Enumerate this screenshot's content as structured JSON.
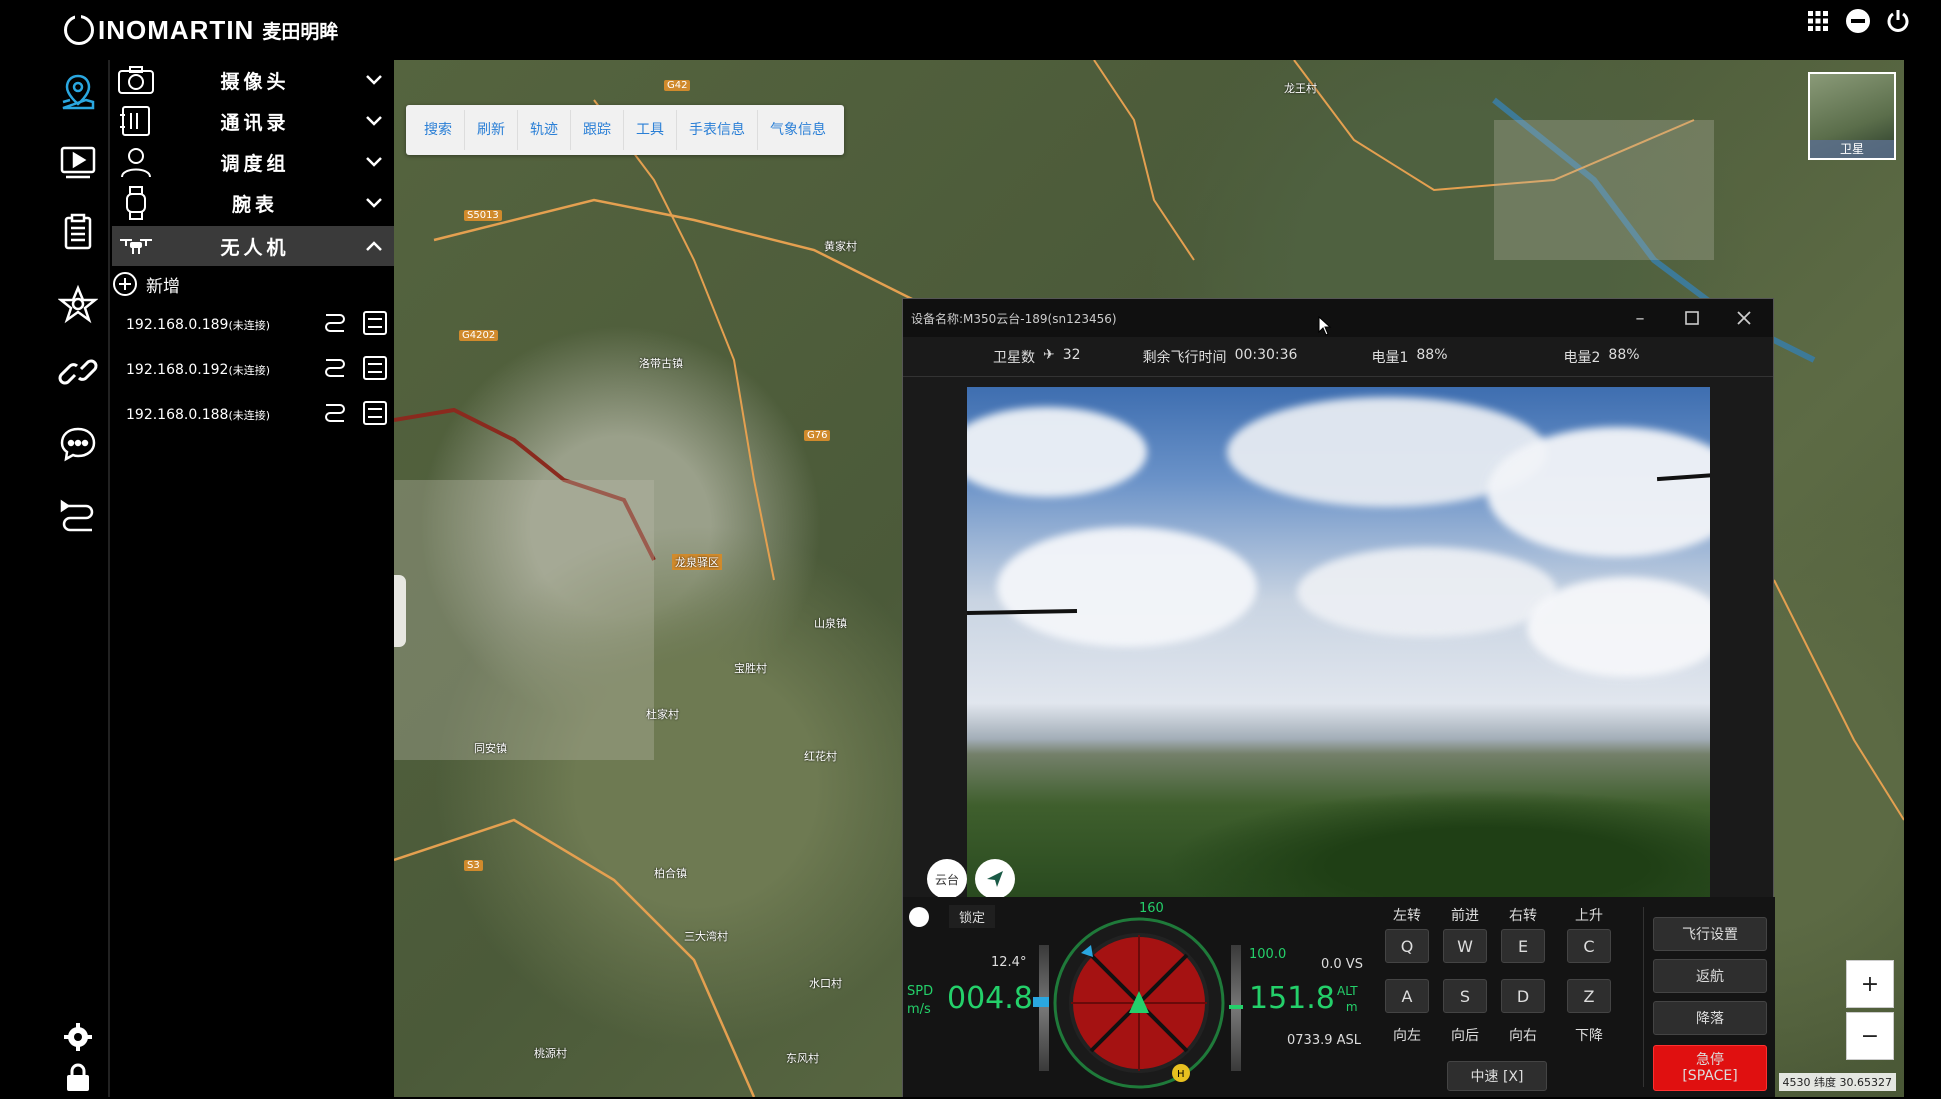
{
  "app": {
    "logo_text": "INOMARTIN",
    "logo_cn": "麦田明眸"
  },
  "sidebar": {
    "groups": [
      {
        "label": "摄像头"
      },
      {
        "label": "通讯录"
      },
      {
        "label": "调度组"
      },
      {
        "label": "腕表"
      },
      {
        "label": "无人机"
      }
    ],
    "add_label": "新增",
    "devices": [
      {
        "ip": "192.168.0.189",
        "status": "(未连接)"
      },
      {
        "ip": "192.168.0.192",
        "status": "(未连接)"
      },
      {
        "ip": "192.168.0.188",
        "status": "(未连接)"
      }
    ]
  },
  "map": {
    "toolbar": [
      "搜索",
      "刷新",
      "轨迹",
      "跟踪",
      "工具",
      "手表信息",
      "气象信息"
    ],
    "minimap_label": "卫星",
    "zoom_in": "+",
    "zoom_out": "−",
    "coords": "4530 纬度 30.65327",
    "place_labels": [
      "龙王村",
      "黄家村",
      "洛带古镇",
      "龙泉驿区",
      "山泉镇",
      "宝胜村",
      "红花村",
      "杜家村",
      "三大湾村",
      "桃源村",
      "水口村",
      "柏合镇",
      "同安镇",
      "东风村"
    ],
    "road_labels": [
      "G42",
      "S5013",
      "G4202",
      "G76",
      "S3"
    ]
  },
  "drone_window": {
    "title": "设备名称:M350云台-189(sn123456)",
    "satellite_label": "卫星数",
    "satellite_value": "32",
    "flight_time_label": "剩余飞行时间",
    "flight_time_value": "00:30:36",
    "battery1_label": "电量1",
    "battery1_value": "88%",
    "battery2_label": "电量2",
    "battery2_value": "88%",
    "gimbal_label": "云台",
    "lock_label": "锁定",
    "pitch": "12.4°",
    "heading": "160",
    "speed_label": "SPD",
    "speed_unit": "m/s",
    "speed_value": "004.8",
    "alt_top": "100.0",
    "vs_value": "0.0 VS",
    "alt_value": "151.8",
    "alt_label": "ALT",
    "alt_unit": "m",
    "asl_value": "0733.9 ASL",
    "keys_top_labels": [
      "左转",
      "前进",
      "右转",
      "上升"
    ],
    "keys_row1": [
      "Q",
      "W",
      "E",
      "C"
    ],
    "keys_row2": [
      "A",
      "S",
      "D",
      "Z"
    ],
    "keys_bottom_labels": [
      "向左",
      "向后",
      "向右",
      "下降"
    ],
    "speed_mode": "中速 [X]",
    "btn_flight_settings": "飞行设置",
    "btn_return": "返航",
    "btn_land": "降落",
    "btn_emergency": "急停",
    "btn_emergency_key": "[SPACE]"
  },
  "colors": {
    "accent": "#2aa7e0",
    "emergency": "#e01010",
    "hud_green": "#24d06a"
  }
}
